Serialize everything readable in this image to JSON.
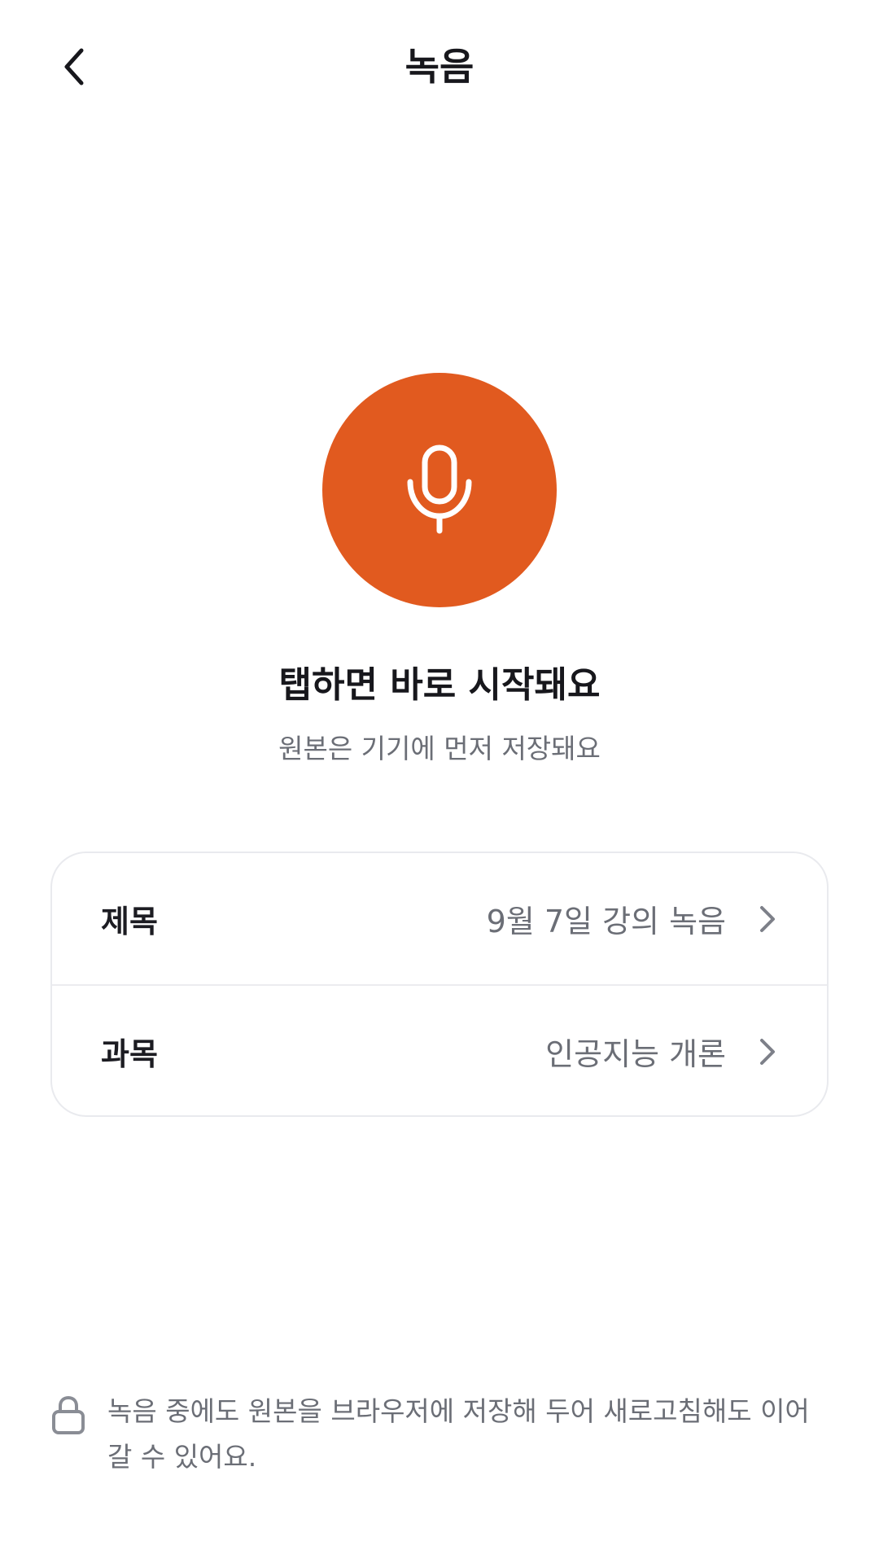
{
  "header": {
    "back_icon": "chevron-left-icon",
    "title": "녹음"
  },
  "record": {
    "icon": "microphone-icon",
    "button_color": "#e15a1f",
    "headline": "탭하면 바로 시작돼요",
    "subline": "원본은 기기에 먼저 저장돼요"
  },
  "settings": {
    "rows": [
      {
        "label": "제목",
        "value": "9월 7일 강의 녹음",
        "icon": "chevron-right-icon"
      },
      {
        "label": "과목",
        "value": "인공지능 개론",
        "icon": "chevron-right-icon"
      }
    ]
  },
  "notice": {
    "icon": "lock-icon",
    "text": "녹음 중에도 원본을 브라우저에 저장해 두어 새로고침해도 이어갈 수 있어요."
  }
}
